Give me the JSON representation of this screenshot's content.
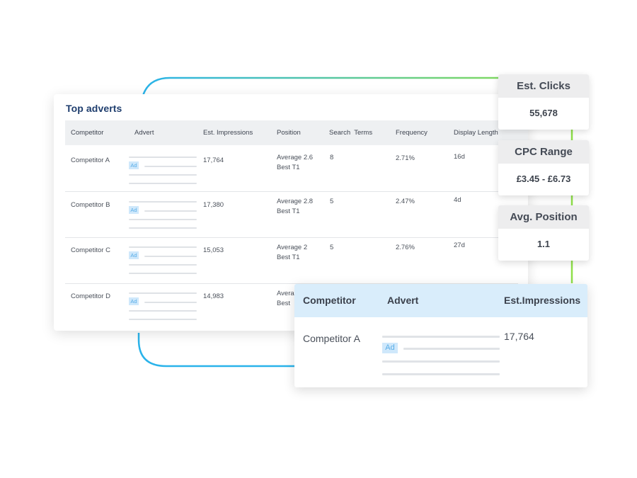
{
  "top_adverts": {
    "title": "Top adverts",
    "columns": [
      "Competitor",
      "Advert",
      "Est. Impressions",
      "Position",
      "Search  Terms",
      "Frequency",
      "Display Length"
    ],
    "ad_badge": "Ad",
    "rows": [
      {
        "competitor": "Competitor A",
        "impressions": "17,764",
        "position_line1": "Average 2.6",
        "position_line2": "Best T1",
        "search_terms": "8",
        "frequency": "2.71%",
        "display_length": "16d"
      },
      {
        "competitor": "Competitor B",
        "impressions": "17,380",
        "position_line1": "Average 2.8",
        "position_line2": "Best T1",
        "search_terms": "5",
        "frequency": "2.47%",
        "display_length": "4d"
      },
      {
        "competitor": "Competitor C",
        "impressions": "15,053",
        "position_line1": "Average 2",
        "position_line2": "Best T1",
        "search_terms": "5",
        "frequency": "2.76%",
        "display_length": "27d"
      },
      {
        "competitor": "Competitor D",
        "impressions": "14,983",
        "position_line1": "Avera",
        "position_line2": "Best",
        "search_terms": "",
        "frequency": "",
        "display_length": ""
      }
    ]
  },
  "stats": [
    {
      "label": "Est. Clicks",
      "value": "55,678"
    },
    {
      "label": "CPC Range",
      "value": "£3.45 - £6.73"
    },
    {
      "label": "Avg. Position",
      "value": "1.1"
    }
  ],
  "detail": {
    "columns": [
      "Competitor",
      "Advert",
      "Est.Impressions"
    ],
    "competitor": "Competitor A",
    "ad_badge": "Ad",
    "impressions": "17,764"
  },
  "colors": {
    "connector_start": "#2ab3ea",
    "connector_end": "#8fe04a",
    "title": "#1f3e6e",
    "ad_badge_bg": "#cfe8fb",
    "popup_header_bg": "#d9edfb"
  }
}
